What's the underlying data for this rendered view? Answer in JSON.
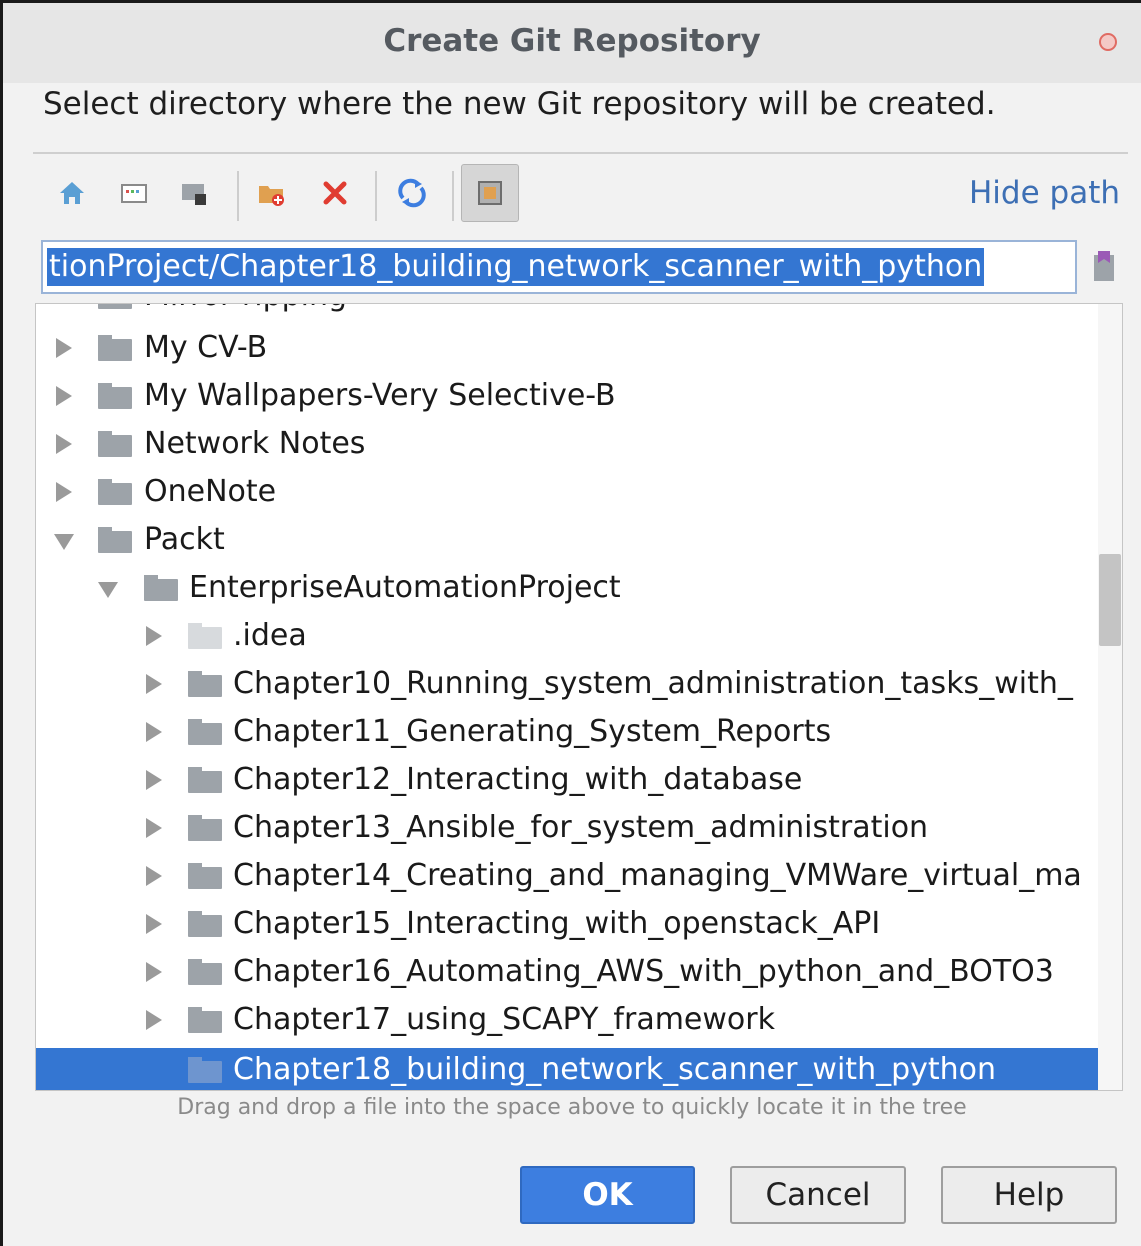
{
  "dialog": {
    "title": "Create Git Repository",
    "subtitle": "Select directory where the new Git repository will be created."
  },
  "toolbar": {
    "icons": [
      "home-icon",
      "desktop-icon",
      "project-icon",
      "new-folder-icon",
      "delete-icon",
      "refresh-icon",
      "show-hidden-icon"
    ],
    "hide_path_label": "Hide path"
  },
  "path_field": {
    "value": "tionProject/Chapter18_building_network_scanner_with_python"
  },
  "tree": {
    "partial_top_label": "Mirror ripping",
    "rows": [
      {
        "label": "My CV-B"
      },
      {
        "label": "My Wallpapers-Very Selective-B"
      },
      {
        "label": "Network Notes"
      },
      {
        "label": "OneNote"
      },
      {
        "label": "Packt"
      },
      {
        "label": "EnterpriseAutomationProject"
      },
      {
        "label": ".idea"
      },
      {
        "label": "Chapter10_Running_system_administration_tasks_with_"
      },
      {
        "label": "Chapter11_Generating_System_Reports"
      },
      {
        "label": "Chapter12_Interacting_with_database"
      },
      {
        "label": "Chapter13_Ansible_for_system_administration"
      },
      {
        "label": "Chapter14_Creating_and_managing_VMWare_virtual_ma"
      },
      {
        "label": "Chapter15_Interacting_with_openstack_API"
      },
      {
        "label": "Chapter16_Automating_AWS_with_python_and_BOTO3"
      },
      {
        "label": "Chapter17_using_SCAPY_framework"
      },
      {
        "label": "Chapter18_building_network_scanner_with_python"
      }
    ]
  },
  "hint": "Drag and drop a file into the space above to quickly locate it in the tree",
  "buttons": {
    "ok": "OK",
    "cancel": "Cancel",
    "help": "Help"
  }
}
